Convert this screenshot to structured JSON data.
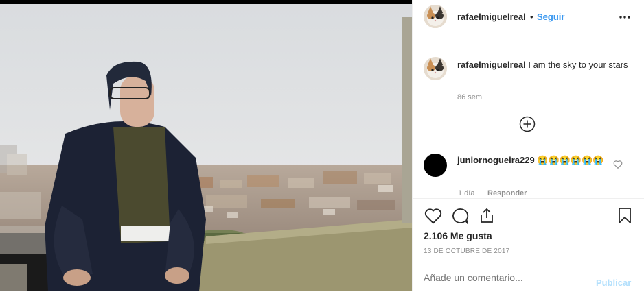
{
  "post": {
    "username": "rafaelmiguelreal",
    "follow_separator": "•",
    "follow_label": "Seguir",
    "more_icon": "more-horizontal-icon"
  },
  "caption": {
    "username": "rafaelmiguelreal",
    "text": "I am the sky to your stars",
    "time": "86 sem"
  },
  "load_more_icon": "plus-circle-icon",
  "comments": [
    {
      "username": "juniornogueira229",
      "text": "😭😭😭😭😭😭",
      "time": "1 día",
      "reply_label": "Responder",
      "like_icon": "heart-outline-icon"
    }
  ],
  "actions": {
    "like_icon": "heart-outline-icon",
    "comment_icon": "comment-bubble-icon",
    "share_icon": "share-upload-icon",
    "save_icon": "bookmark-icon"
  },
  "likes_text": "2.106 Me gusta",
  "date_text": "13 DE OCTUBRE DE 2017",
  "comment_box": {
    "placeholder": "Añade un comentario...",
    "publish_label": "Publicar"
  },
  "colors": {
    "link_blue": "#3897f0",
    "publish_disabled": "#b2dffc",
    "text": "#262626",
    "muted": "#8e8e8e"
  }
}
